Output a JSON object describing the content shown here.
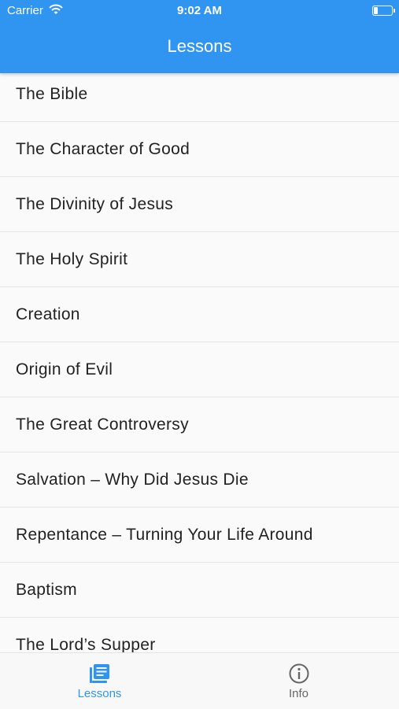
{
  "status_bar": {
    "carrier": "Carrier",
    "time": "9:02 AM"
  },
  "header": {
    "title": "Lessons"
  },
  "lessons": [
    "The Bible",
    "The Character of Good",
    "The Divinity of Jesus",
    "The Holy Spirit",
    "Creation",
    "Origin of Evil",
    "The Great Controversy",
    "Salvation – Why Did Jesus Die",
    "Repentance – Turning Your Life Around",
    "Baptism",
    "The Lord’s Supper"
  ],
  "tabs": [
    {
      "label": "Lessons",
      "icon": "book-list-icon",
      "active": true
    },
    {
      "label": "Info",
      "icon": "info-circle-icon",
      "active": false
    }
  ],
  "colors": {
    "accent": "#2f95f0",
    "tab_inactive": "#666666"
  }
}
